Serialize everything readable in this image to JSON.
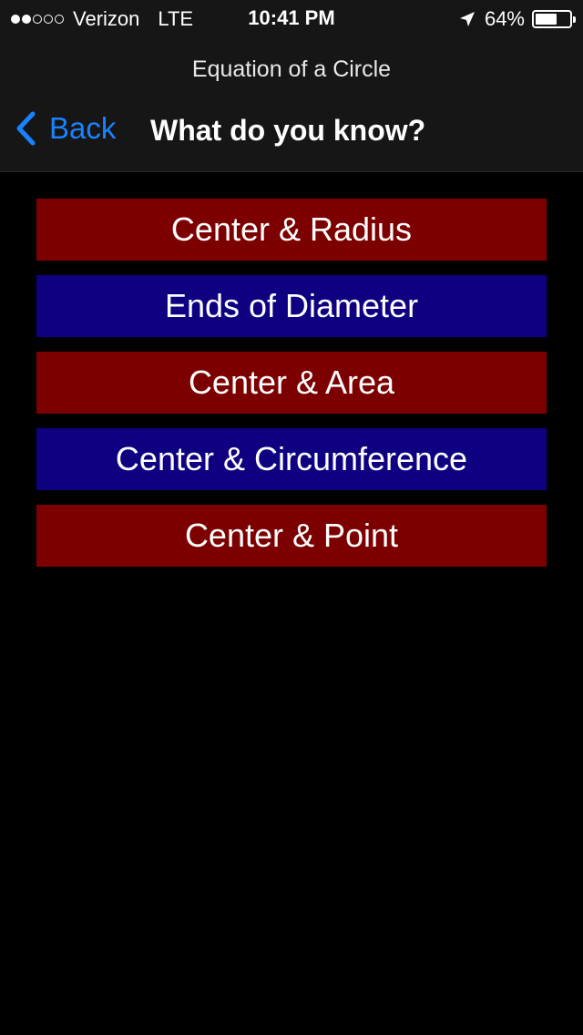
{
  "status_bar": {
    "signal_filled": 2,
    "signal_total": 5,
    "carrier": "Verizon",
    "network": "LTE",
    "time": "10:41 PM",
    "location_icon": "location-arrow-icon",
    "battery_percent_label": "64%",
    "battery_level": 0.64
  },
  "app_bar": {
    "app_title": "Equation of a Circle",
    "back_label": "Back",
    "nav_title": "What do you know?",
    "accent_color": "#1a82ff"
  },
  "options": [
    {
      "label": "Center & Radius",
      "color": "#7d0000"
    },
    {
      "label": "Ends of Diameter",
      "color": "#0e0080"
    },
    {
      "label": "Center & Area",
      "color": "#7d0000"
    },
    {
      "label": "Center & Circumference",
      "color": "#0e0080"
    },
    {
      "label": "Center & Point",
      "color": "#7d0000"
    }
  ]
}
